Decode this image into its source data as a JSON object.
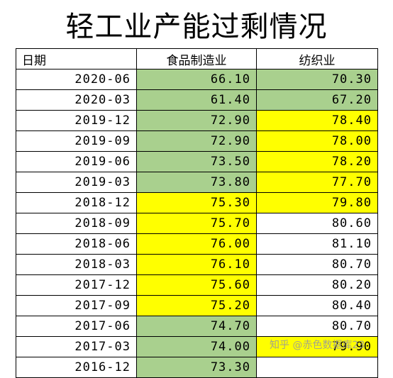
{
  "title": "轻工业产能过剩情况",
  "headers": [
    "日期",
    "食品制造业",
    "纺织业"
  ],
  "colors": {
    "green": "#a9d08e",
    "yellow": "#ffff00",
    "none": "#ffffff"
  },
  "rows": [
    {
      "date": "2020-06",
      "food": "66.10",
      "food_fill": "green",
      "textile": "70.30",
      "textile_fill": "green"
    },
    {
      "date": "2020-03",
      "food": "61.40",
      "food_fill": "green",
      "textile": "67.20",
      "textile_fill": "green"
    },
    {
      "date": "2019-12",
      "food": "72.90",
      "food_fill": "green",
      "textile": "78.40",
      "textile_fill": "yellow"
    },
    {
      "date": "2019-09",
      "food": "72.90",
      "food_fill": "green",
      "textile": "78.00",
      "textile_fill": "yellow"
    },
    {
      "date": "2019-06",
      "food": "73.50",
      "food_fill": "green",
      "textile": "78.20",
      "textile_fill": "yellow"
    },
    {
      "date": "2019-03",
      "food": "73.80",
      "food_fill": "green",
      "textile": "77.70",
      "textile_fill": "yellow"
    },
    {
      "date": "2018-12",
      "food": "75.30",
      "food_fill": "yellow",
      "textile": "79.80",
      "textile_fill": "yellow"
    },
    {
      "date": "2018-09",
      "food": "75.70",
      "food_fill": "yellow",
      "textile": "80.60",
      "textile_fill": "none"
    },
    {
      "date": "2018-06",
      "food": "76.00",
      "food_fill": "yellow",
      "textile": "81.10",
      "textile_fill": "none"
    },
    {
      "date": "2018-03",
      "food": "76.10",
      "food_fill": "yellow",
      "textile": "80.70",
      "textile_fill": "none"
    },
    {
      "date": "2017-12",
      "food": "75.60",
      "food_fill": "yellow",
      "textile": "80.20",
      "textile_fill": "none"
    },
    {
      "date": "2017-09",
      "food": "75.20",
      "food_fill": "yellow",
      "textile": "80.40",
      "textile_fill": "none"
    },
    {
      "date": "2017-06",
      "food": "74.70",
      "food_fill": "green",
      "textile": "80.70",
      "textile_fill": "none"
    },
    {
      "date": "2017-03",
      "food": "74.00",
      "food_fill": "green",
      "textile": "79.90",
      "textile_fill": "yellow"
    },
    {
      "date": "2016-12",
      "food": "73.30",
      "food_fill": "green",
      "textile": "",
      "textile_fill": "none"
    }
  ],
  "watermark": "知乎 @赤色数据库23"
}
